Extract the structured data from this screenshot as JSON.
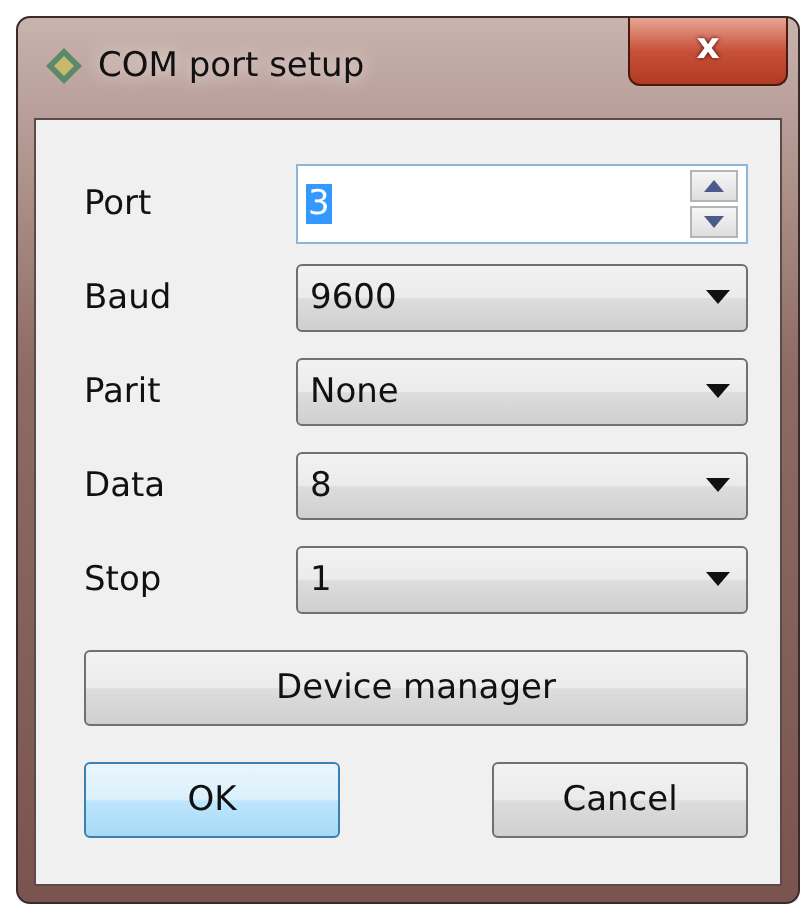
{
  "window": {
    "title": "COM port setup",
    "close": "x"
  },
  "fields": [
    {
      "label": "Port",
      "kind": "spin",
      "value": "3",
      "text_selected": true
    },
    {
      "label": "Baud",
      "kind": "select",
      "value": "9600"
    },
    {
      "label": "Parit",
      "kind": "select",
      "value": "None"
    },
    {
      "label": "Data",
      "kind": "select",
      "value": "8"
    },
    {
      "label": "Stop",
      "kind": "select",
      "value": "1"
    }
  ],
  "device_button": "Device manager",
  "buttons": [
    {
      "label": "OK",
      "default": true
    },
    {
      "label": "Cancel",
      "default": false
    }
  ]
}
